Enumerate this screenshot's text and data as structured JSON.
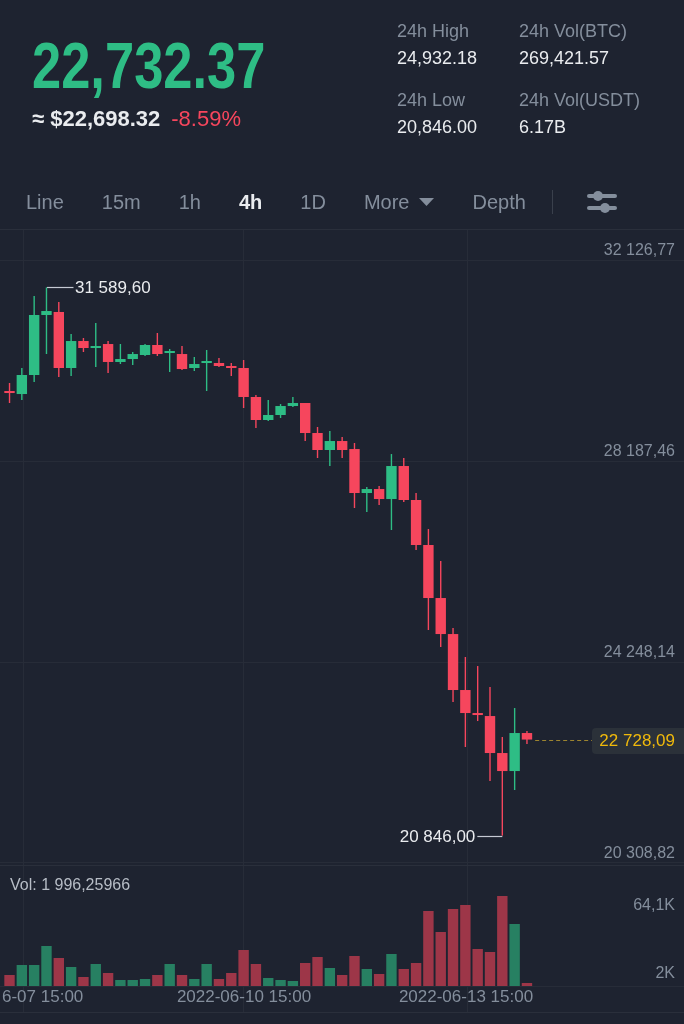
{
  "ticker": {
    "last_price": "22,732.37",
    "fiat_price": "≈ $22,698.32",
    "change": "-8.59%"
  },
  "stats": [
    {
      "label": "24h High",
      "value": "24,932.18"
    },
    {
      "label": "24h Vol(BTC)",
      "value": "269,421.57"
    },
    {
      "label": "24h Low",
      "value": "20,846.00"
    },
    {
      "label": "24h Vol(USDT)",
      "value": "6.17B"
    }
  ],
  "intervals": [
    {
      "label": "Line",
      "kind": "tab",
      "selected": false
    },
    {
      "label": "15m",
      "kind": "tab",
      "selected": false
    },
    {
      "label": "1h",
      "kind": "tab",
      "selected": false
    },
    {
      "label": "4h",
      "kind": "tab",
      "selected": true
    },
    {
      "label": "1D",
      "kind": "tab",
      "selected": false
    },
    {
      "label": "More",
      "kind": "menu",
      "selected": false
    },
    {
      "label": "Depth",
      "kind": "tab",
      "selected": false
    }
  ],
  "price_chart": {
    "chart_data": {
      "type": "candlestick",
      "categories": [
        null,
        null,
        null,
        null,
        null,
        null,
        null,
        null,
        null,
        null,
        null,
        null,
        null,
        null,
        null,
        null,
        null,
        null,
        null,
        null,
        null,
        null,
        null,
        null,
        null,
        null,
        null,
        null,
        null,
        null,
        null,
        null,
        null,
        null,
        null,
        null,
        null,
        null,
        null,
        null,
        null,
        null,
        null
      ],
      "ohlc": [
        [
          29559,
          29716,
          29324,
          29520
        ],
        [
          29500,
          30010,
          29383,
          29873
        ],
        [
          29873,
          31421,
          29736,
          31049
        ],
        [
          31049,
          31589.6,
          30284,
          31127
        ],
        [
          31108,
          31304,
          29834,
          30010
        ],
        [
          30010,
          30676,
          29853,
          30539
        ],
        [
          30539,
          30598,
          30324,
          30402
        ],
        [
          30402,
          30892,
          30030,
          30441
        ],
        [
          30480,
          30539,
          29912,
          30128
        ],
        [
          30128,
          30480,
          30088,
          30186
        ],
        [
          30186,
          30324,
          30069,
          30284
        ],
        [
          30265,
          30480,
          30245,
          30461
        ],
        [
          30461,
          30696,
          30245,
          30284
        ],
        [
          30304,
          30382,
          29932,
          30343
        ],
        [
          30284,
          30441,
          29971,
          29990
        ],
        [
          30010,
          30226,
          29951,
          30088
        ],
        [
          30108,
          30363,
          29559,
          30147
        ],
        [
          30108,
          30206,
          30030,
          30049
        ],
        [
          30049,
          30108,
          29853,
          30010
        ],
        [
          30010,
          30167,
          29226,
          29442
        ],
        [
          29442,
          29481,
          28834,
          28991
        ],
        [
          28991,
          29383,
          28971,
          29089
        ],
        [
          29089,
          29304,
          29030,
          29265
        ],
        [
          29265,
          29442,
          29246,
          29324
        ],
        [
          29324,
          29324,
          28579,
          28736
        ],
        [
          28736,
          28854,
          28246,
          28403
        ],
        [
          28403,
          28775,
          28089,
          28579
        ],
        [
          28579,
          28658,
          28246,
          28403
        ],
        [
          28422,
          28540,
          27266,
          27560
        ],
        [
          27560,
          27678,
          27188,
          27638
        ],
        [
          27638,
          27697,
          27325,
          27442
        ],
        [
          27442,
          28324,
          26835,
          28089
        ],
        [
          28089,
          28246,
          27384,
          27423
        ],
        [
          27423,
          27560,
          26443,
          26541
        ],
        [
          26541,
          26854,
          24875,
          25502
        ],
        [
          25502,
          26227,
          24542,
          24796
        ],
        [
          24796,
          24914,
          23464,
          23699
        ],
        [
          23699,
          24346,
          22582,
          23248
        ],
        [
          23248,
          24169,
          23091,
          23209
        ],
        [
          23189,
          23758,
          21915,
          22464
        ],
        [
          22464,
          22778,
          20846,
          22111
        ],
        [
          22111,
          23346,
          21739,
          22856
        ],
        [
          22856,
          22895,
          22640,
          22728.09
        ]
      ],
      "ylim": [
        20308.82,
        32126.77
      ],
      "yticks": [
        {
          "value": 32126.77,
          "label": "32 126,77"
        },
        {
          "value": 28187.46,
          "label": "28 187,46"
        },
        {
          "value": 24248.14,
          "label": "24 248,14"
        },
        {
          "value": 20308.82,
          "label": "20 308,82"
        }
      ],
      "grid": true,
      "ref_lines": [
        {
          "axis": "y",
          "value": 22728.09,
          "label": "22 728,09"
        }
      ]
    },
    "high_marker": "31 589,60",
    "low_marker": "20 846,00"
  },
  "volume_chart": {
    "label": "Vol: 1 996,25966",
    "volume_axis": [
      "64,1K",
      "2K"
    ],
    "time_axis": [
      "6-07 15:00",
      "2022-06-10 15:00",
      "2022-06-13 15:00"
    ]
  }
}
